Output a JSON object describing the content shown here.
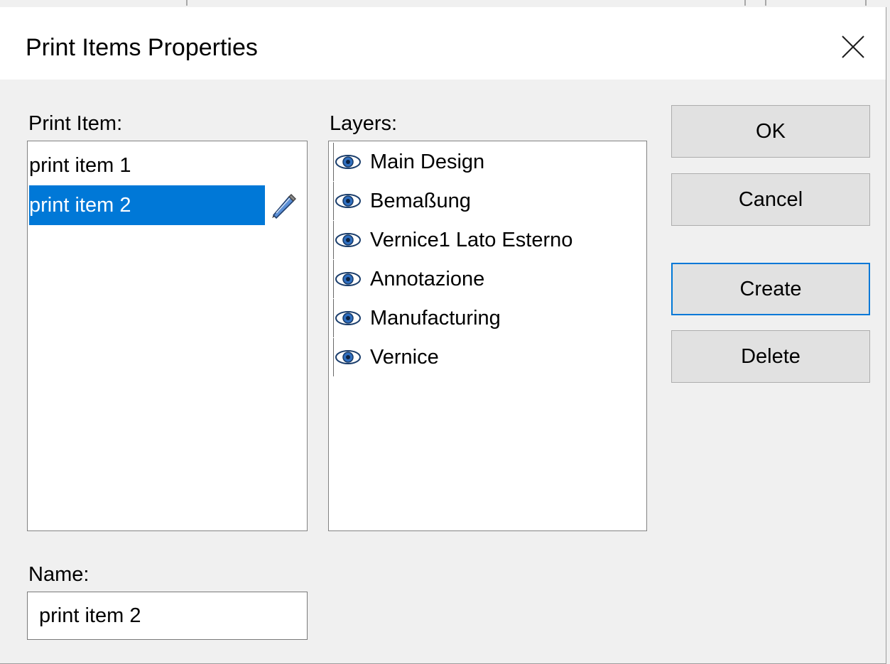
{
  "dialog": {
    "title": "Print Items Properties"
  },
  "print_items": {
    "label": "Print Item:",
    "items": [
      "print item 1",
      "print item 2"
    ],
    "selected_index": 1
  },
  "layers": {
    "label": "Layers:",
    "items": [
      {
        "label": "Main Design",
        "visible": true
      },
      {
        "label": "Bemaßung",
        "visible": true
      },
      {
        "label": "Vernice1 Lato Esterno",
        "visible": true
      },
      {
        "label": "Annotazione",
        "visible": true
      },
      {
        "label": "Manufacturing",
        "visible": true
      },
      {
        "label": "Vernice",
        "visible": true
      }
    ]
  },
  "buttons": {
    "ok": "OK",
    "cancel": "Cancel",
    "create": "Create",
    "delete": "Delete"
  },
  "name": {
    "label": "Name:",
    "value": "print item 2"
  },
  "colors": {
    "selection": "#0078d7",
    "eye": "#1a5fa8"
  },
  "icons": {
    "close": "close-icon",
    "edit": "pencil-icon",
    "visibility": "eye-icon"
  }
}
